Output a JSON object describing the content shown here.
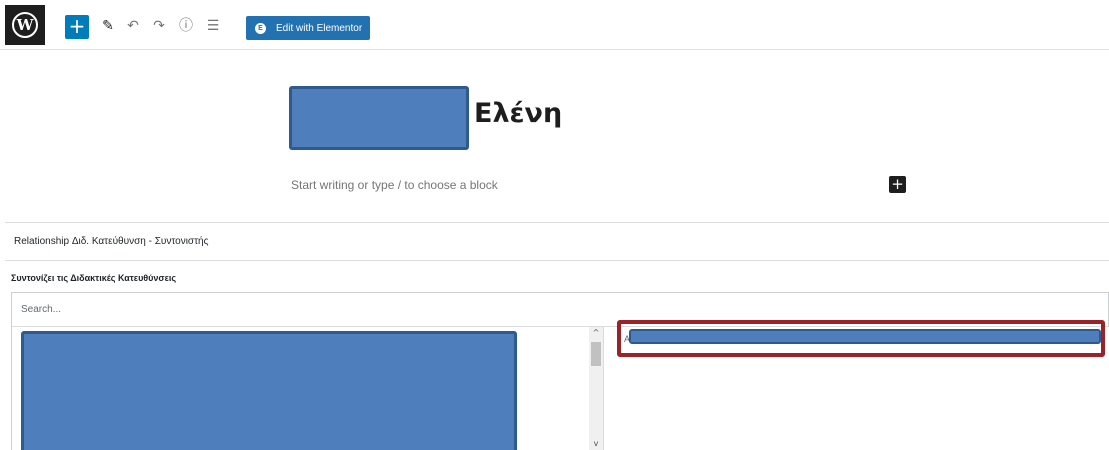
{
  "toolbar": {
    "logo_icon": "wordpress-logo-icon",
    "logo_glyph": "W",
    "add_block_glyph": "+",
    "edit_glyph": "✎",
    "undo_glyph": "↶",
    "redo_glyph": "↷",
    "info_glyph": "ⓘ",
    "list_view_glyph": "☰",
    "elementor_label": "Edit with Elementor",
    "elementor_glyph": "E"
  },
  "editor": {
    "title": "Ελένη",
    "block_placeholder": "Start writing or type / to choose a block",
    "block_add_glyph": "+"
  },
  "metabox": {
    "title": "Relationship Διδ. Κατεύθυνση - Συντονιστής",
    "field_label": "Συντονίζει τις Διδακτικές Κατευθύνσεις",
    "search_placeholder": "Search...",
    "scroll_up_glyph": "^",
    "scroll_down_glyph": "v",
    "selected_visible_char": "A"
  },
  "colors": {
    "primary": "#007cba",
    "elementor": "#2271b1",
    "redaction": "#4f7ebc",
    "highlight_border": "#9b2226"
  }
}
